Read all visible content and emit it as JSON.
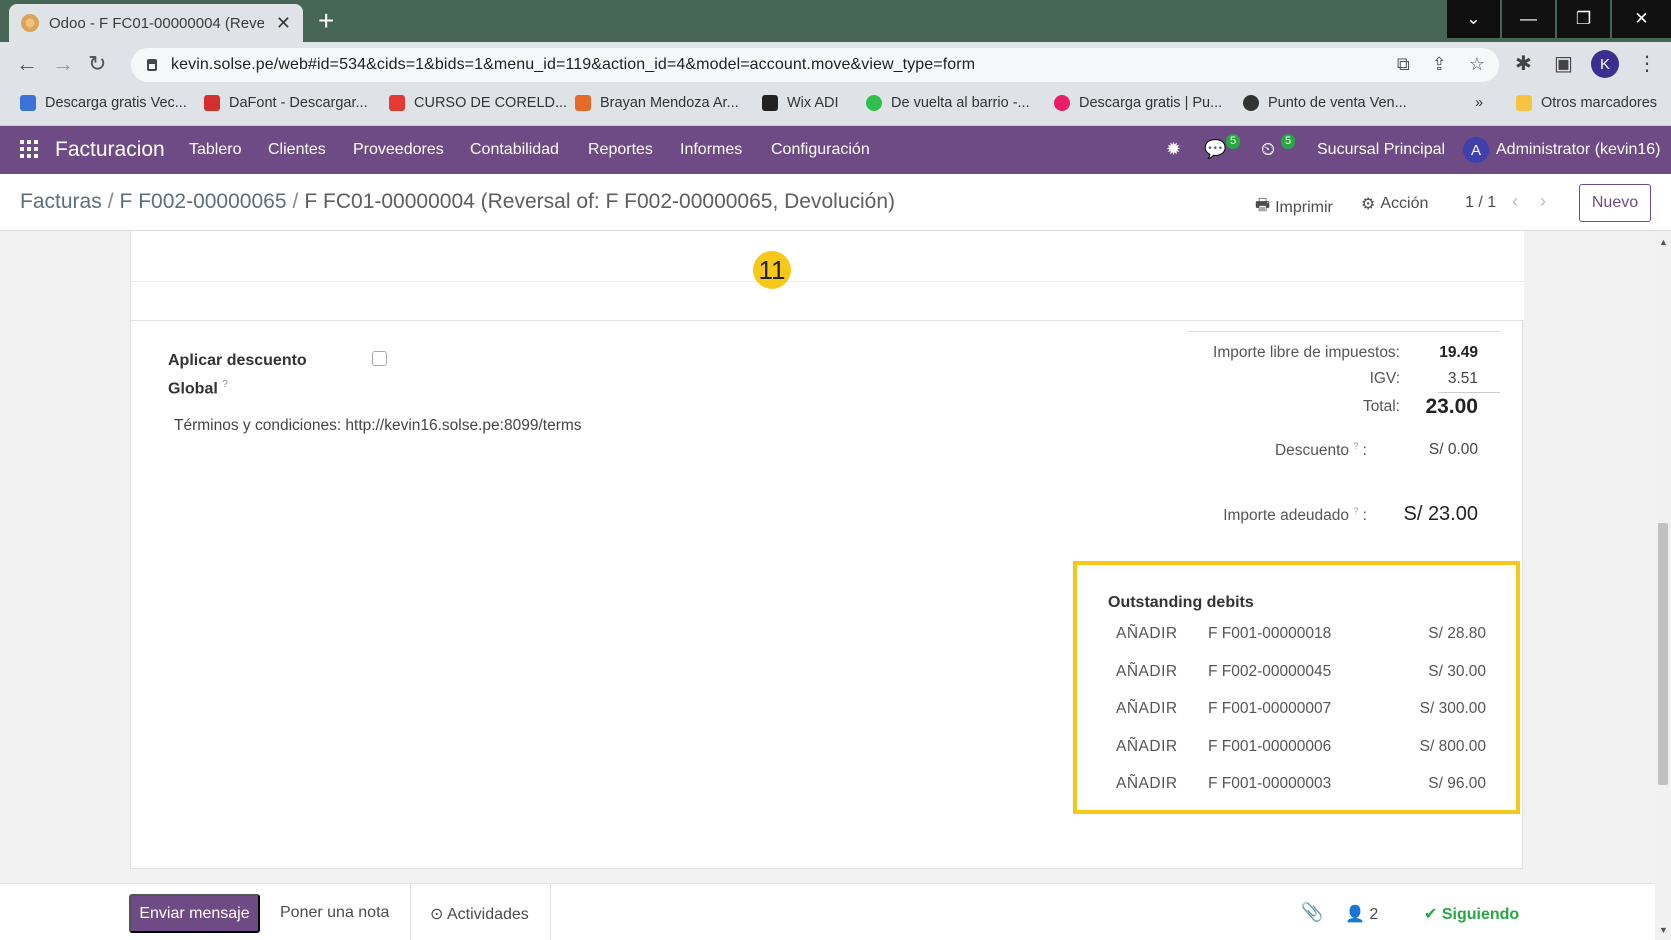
{
  "browser": {
    "tab_title": "Odoo - F FC01-00000004 (Reversal of: F F002-00000065, Devolución)",
    "url": "kevin.solse.pe/web#id=534&cids=1&bids=1&menu_id=119&action_id=4&model=account.move&view_type=form",
    "profile_initial": "K",
    "bookmarks": [
      {
        "label": "Descarga gratis Vec...",
        "color": "#3b73d6"
      },
      {
        "label": "DaFont - Descargar...",
        "color": "#d32f2f"
      },
      {
        "label": "CURSO DE CORELD...",
        "color": "#e53935"
      },
      {
        "label": "Brayan Mendoza Ar...",
        "color": "#e56a2a"
      },
      {
        "label": "Wix ADI",
        "color": "#222222"
      },
      {
        "label": "De vuelta al barrio -...",
        "color": "#2fbf4f"
      },
      {
        "label": "Descarga gratis | Pu...",
        "color": "#e91e63"
      },
      {
        "label": "Punto de venta Ven...",
        "color": "#333333"
      }
    ],
    "more_bookmarks": "»",
    "other_bookmarks": "Otros marcadores"
  },
  "navbar": {
    "app_name": "Facturacion",
    "menu": [
      "Tablero",
      "Clientes",
      "Proveedores",
      "Contabilidad",
      "Reportes",
      "Informes",
      "Configuración"
    ],
    "messages_count": "5",
    "activities_count": "5",
    "company": "Sucursal Principal",
    "user_initial": "A",
    "user_name": "Administrator (kevin16)"
  },
  "control_panel": {
    "breadcrumb_1": "Facturas",
    "breadcrumb_2": "F F002-00000065",
    "breadcrumb_current": "F FC01-00000004 (Reversal of: F F002-00000065, Devolución)",
    "print_label": "Imprimir",
    "action_label": "Acción",
    "pager": "1 / 1",
    "new_label": "Nuevo"
  },
  "form": {
    "step_number": "11",
    "discount_label_line1": "Aplicar descuento",
    "discount_label_line2": "Global",
    "discount_help": "?",
    "terms": "Términos y condiciones: http://kevin16.solse.pe:8099/terms",
    "totals": {
      "untaxed_label": "Importe libre de impuestos:",
      "untaxed_value": "19.49",
      "igv_label": "IGV:",
      "igv_value": "3.51",
      "total_label": "Total:",
      "total_value": "23.00",
      "discount_label": "Descuento",
      "discount_value": "S/ 0.00",
      "due_label": "Importe adeudado",
      "due_value": "S/ 23.00"
    },
    "outstanding": {
      "title": "Outstanding debits",
      "rows": [
        {
          "action": "AÑADIR",
          "ref": "F F001-00000018",
          "amount": "S/ 28.80"
        },
        {
          "action": "AÑADIR",
          "ref": "F F002-00000045",
          "amount": "S/ 30.00"
        },
        {
          "action": "AÑADIR",
          "ref": "F F001-00000007",
          "amount": "S/ 300.00"
        },
        {
          "action": "AÑADIR",
          "ref": "F F001-00000006",
          "amount": "S/ 800.00"
        },
        {
          "action": "AÑADIR",
          "ref": "F F001-00000003",
          "amount": "S/ 96.00"
        }
      ]
    }
  },
  "chatter": {
    "send_label": "Enviar mensaje",
    "note_label": "Poner una nota",
    "activities_label": "Actividades",
    "followers_count": "2",
    "following_label": "Siguiendo"
  },
  "colors": {
    "odoo_primary": "#6f4b85",
    "highlight": "#f6c81a",
    "success": "#28a745"
  }
}
